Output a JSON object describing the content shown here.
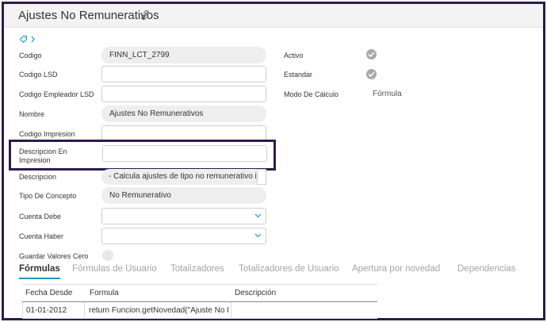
{
  "header": {
    "title": "Ajustes No Remunerativos"
  },
  "form": {
    "codigo": {
      "label": "Codigo",
      "value": "FINN_LCT_2799"
    },
    "codigo_lsd": {
      "label": "Codigo LSD",
      "value": ""
    },
    "codigo_empleador_lsd": {
      "label": "Codigo Empleador LSD",
      "value": ""
    },
    "nombre": {
      "label": "Nombre",
      "value": "Ajustes No Remunerativos"
    },
    "codigo_impresion": {
      "label": "Codigo Impresion",
      "value": ""
    },
    "descripcion_en_impresion": {
      "label_line1": "Descripcion En",
      "label_line2": "Impresion",
      "value": ""
    },
    "descripcion": {
      "label": "Descripcion",
      "value": "- Calcula ajustes de tipo no remunerativo info"
    },
    "tipo_de_concepto": {
      "label": "Tipo De Concepto",
      "value": "No Remunerativo"
    },
    "cuenta_debe": {
      "label": "Cuenta Debe",
      "value": ""
    },
    "cuenta_haber": {
      "label": "Cuenta Haber",
      "value": ""
    },
    "guardar_valores_cero": {
      "label": "Guardar Valores Cero"
    }
  },
  "right": {
    "activo": {
      "label": "Activo"
    },
    "estandar": {
      "label": "Estandar"
    },
    "modo_de_calculo": {
      "label": "Modo De Cálculo",
      "value": "Fórmula"
    }
  },
  "tabs": [
    {
      "label": "Fórmulas"
    },
    {
      "label": "Fórmulas de Usuario"
    },
    {
      "label": "Totalizadores"
    },
    {
      "label": "Totalizadores de Usuario"
    },
    {
      "label": "Apertura por novedad"
    },
    {
      "label": "Dependencias"
    }
  ],
  "grid": {
    "columns": [
      "Fecha Desde",
      "Formula",
      "Descripción"
    ],
    "rows": [
      {
        "fecha_desde": "01-01-2012",
        "formula": "return Funcion.getNovedad(\"Ajuste No R...",
        "descripcion": ""
      }
    ]
  },
  "colors": {
    "highlight_border": "#2c1c4a",
    "active_tab_underline": "#1f97c0",
    "check_gray": "#a9a9a9",
    "tag_icon": "#1f97c0"
  },
  "icons": [
    "link-icon",
    "tag-icon",
    "chevron-right-icon",
    "check-icon",
    "chevron-down-icon"
  ]
}
